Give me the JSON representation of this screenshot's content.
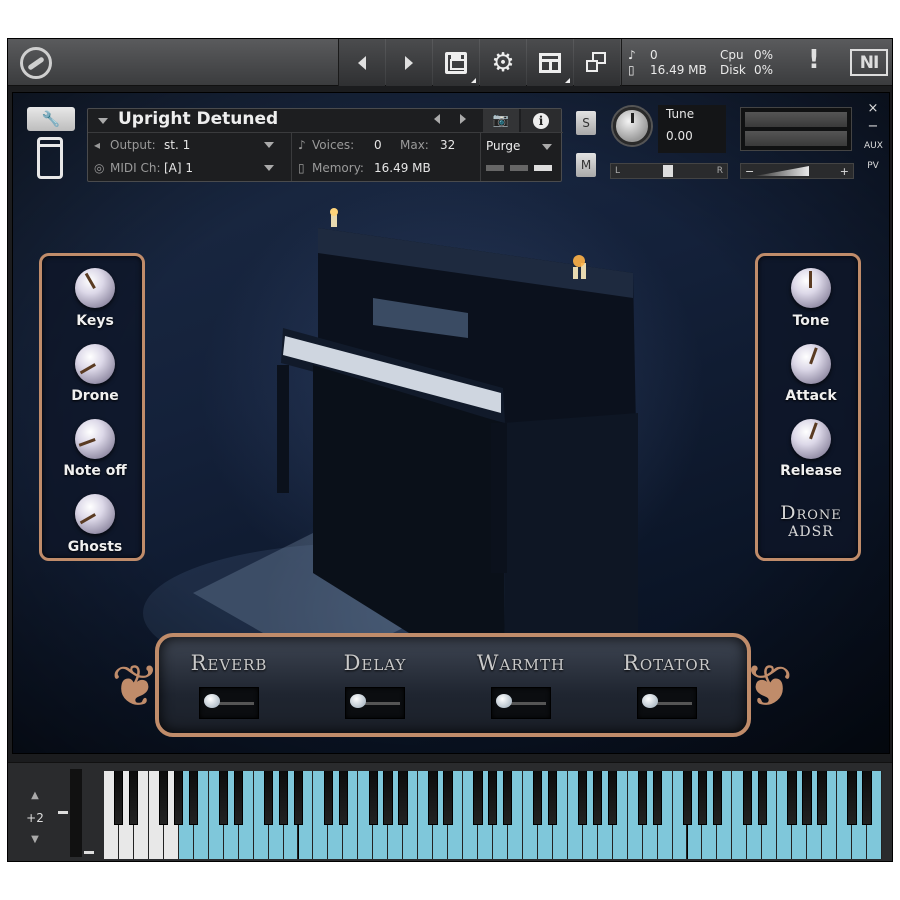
{
  "topbar": {
    "icons": [
      "kontakt-logo-icon",
      "prev-icon",
      "next-icon",
      "save-icon",
      "gear-icon",
      "layout-icon",
      "resize-icon",
      "warning-icon",
      "ni-logo-icon"
    ],
    "voices_stat": "0",
    "memory_stat": "16.49 MB",
    "cpu_label": "Cpu",
    "cpu_value": "0%",
    "disk_label": "Disk",
    "disk_value": "0%",
    "warning": "!",
    "ni_logo": "NI"
  },
  "header": {
    "instrument_name": "Upright Detuned",
    "output_label": "Output:",
    "output_value": "st. 1",
    "voices_label": "Voices:",
    "voices_value": "0",
    "max_label": "Max:",
    "max_value": "32",
    "midi_label": "MIDI Ch:",
    "midi_value": "[A]  1",
    "memory_label": "Memory:",
    "memory_value": "16.49 MB",
    "purge_label": "Purge",
    "solo": "S",
    "mute": "M",
    "tune_label": "Tune",
    "tune_value": "0.00",
    "pan_left": "L",
    "pan_right": "R",
    "vol_minus": "−",
    "vol_plus": "+",
    "close": "×",
    "minimize": "−",
    "aux": "AUX",
    "pv": "PV"
  },
  "left_panel": {
    "knobs": [
      {
        "label": "Keys",
        "angle": 150
      },
      {
        "label": "Drone",
        "angle": 60
      },
      {
        "label": "Note off",
        "angle": 70
      },
      {
        "label": "Ghosts",
        "angle": 60
      }
    ]
  },
  "right_panel": {
    "knobs": [
      {
        "label": "Tone",
        "angle": 180
      },
      {
        "label": "Attack",
        "angle": 200
      },
      {
        "label": "Release",
        "angle": 200
      }
    ],
    "title": "Drone",
    "subtitle": "ADSR"
  },
  "fx": [
    {
      "label": "Reverb"
    },
    {
      "label": "Delay"
    },
    {
      "label": "Warmth"
    },
    {
      "label": "Rotator"
    }
  ],
  "keyboard": {
    "octave": "+2",
    "white_keys": 52,
    "grey_white_keys": 5,
    "key_color_active": "#7fc7da",
    "key_color_inactive": "#e8e8e8"
  },
  "colors": {
    "panel_border": "#c08c6a",
    "background": "#14213a"
  }
}
